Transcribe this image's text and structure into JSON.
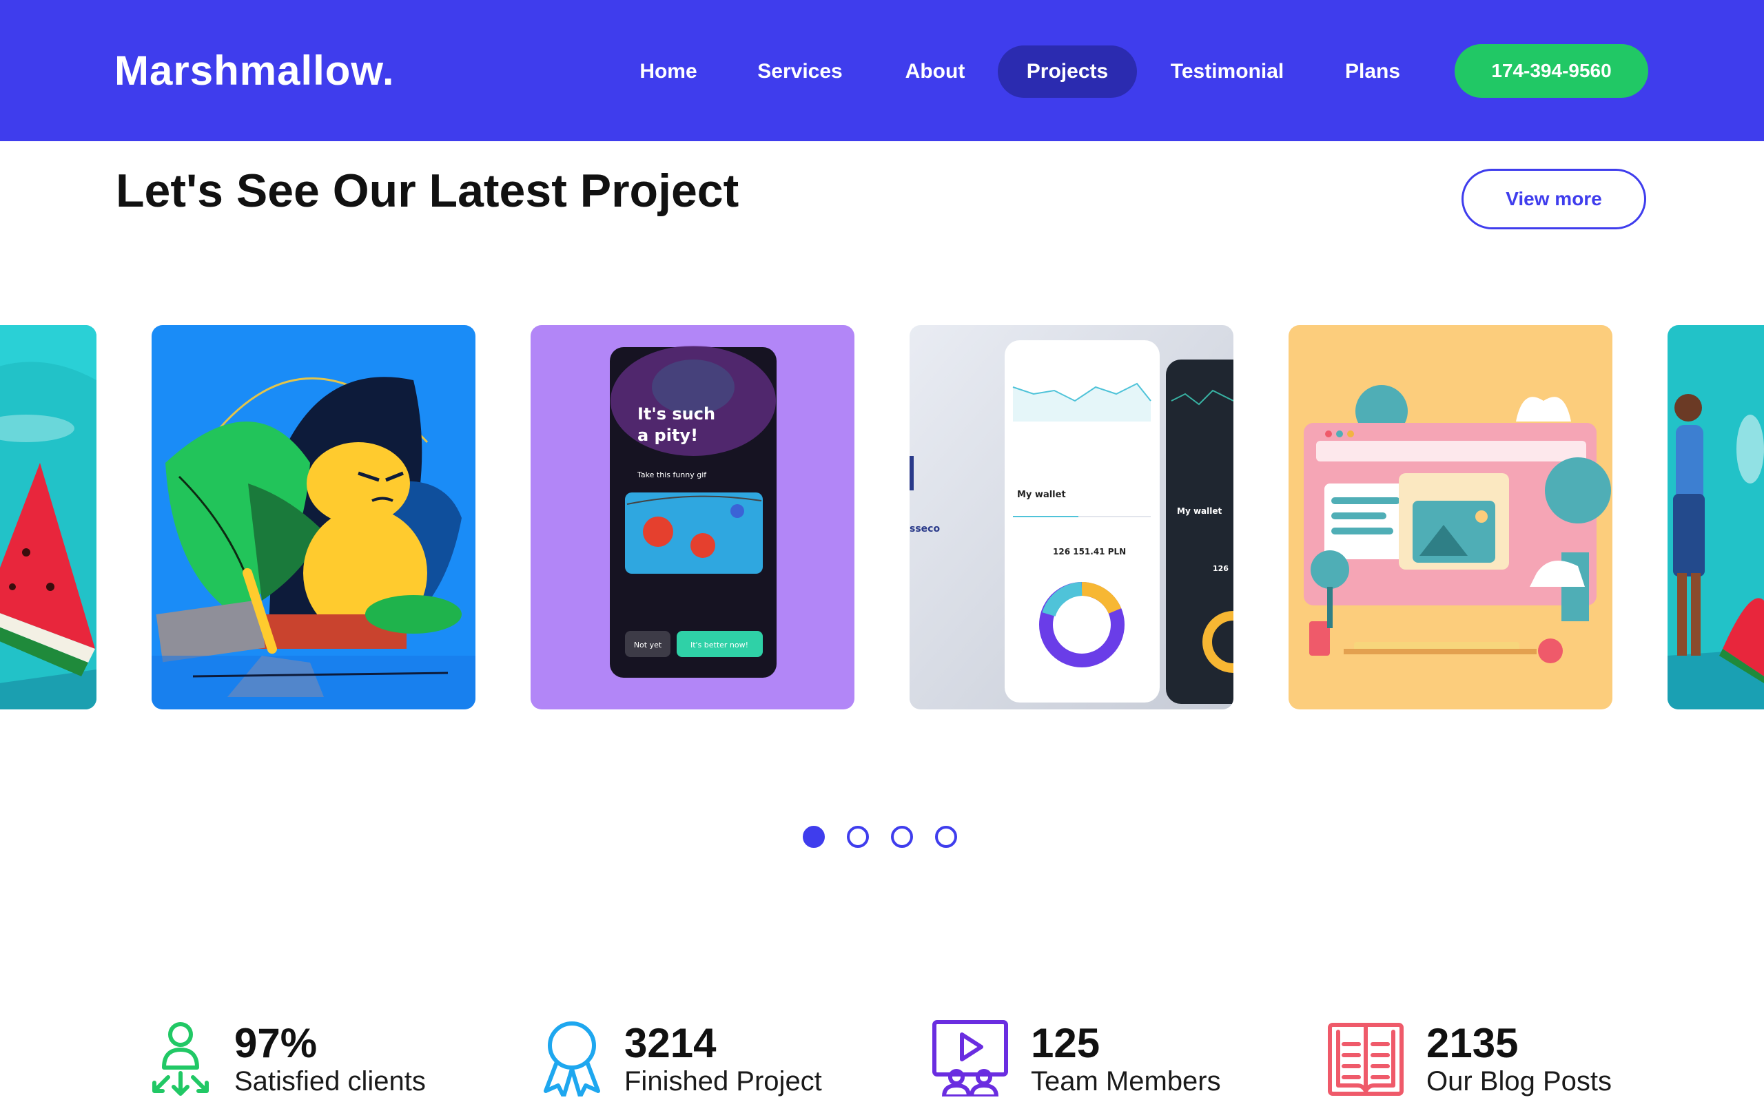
{
  "header": {
    "logo": "Marshmallow.",
    "nav": [
      {
        "label": "Home",
        "active": false
      },
      {
        "label": "Services",
        "active": false
      },
      {
        "label": "About",
        "active": false
      },
      {
        "label": "Projects",
        "active": true
      },
      {
        "label": "Testimonial",
        "active": false
      },
      {
        "label": "Plans",
        "active": false
      }
    ],
    "phone": "174-394-9560",
    "colors": {
      "bar": "#3f3ded",
      "active_pill": "#2b2bb0",
      "cta": "#21c865"
    }
  },
  "section": {
    "title": "Let's See Our Latest Project",
    "view_more": "View more"
  },
  "carousel": {
    "cards": [
      {
        "name": "watermelon-illustration"
      },
      {
        "name": "character-leaves-illustration"
      },
      {
        "name": "mobile-app-mockup",
        "texts": {
          "headline_1": "It's such",
          "headline_2": "a pity!",
          "sub": "Take this funny gif",
          "btn_no": "Not yet",
          "btn_yes": "It's better now!"
        }
      },
      {
        "name": "wallet-app-mockup",
        "texts": {
          "title": "My wallet",
          "amount": "126 151.41 PLN",
          "brand": "sseco",
          "title_2": "My wallet",
          "amount_2": "126"
        }
      },
      {
        "name": "desktop-3d-illustration"
      },
      {
        "name": "person-beach-illustration"
      }
    ],
    "pagination": {
      "total": 4,
      "active_index": 0
    }
  },
  "stats": [
    {
      "value": "97%",
      "label": "Satisfied clients",
      "icon": "user-arrows-icon",
      "color": "#21c865"
    },
    {
      "value": "3214",
      "label": "Finished Project",
      "icon": "award-ribbon-icon",
      "color": "#1ea7ef"
    },
    {
      "value": "125",
      "label": "Team Members",
      "icon": "video-team-icon",
      "color": "#6a2de0"
    },
    {
      "value": "2135",
      "label": "Our Blog Posts",
      "icon": "open-book-icon",
      "color": "#ef5a6a"
    }
  ]
}
